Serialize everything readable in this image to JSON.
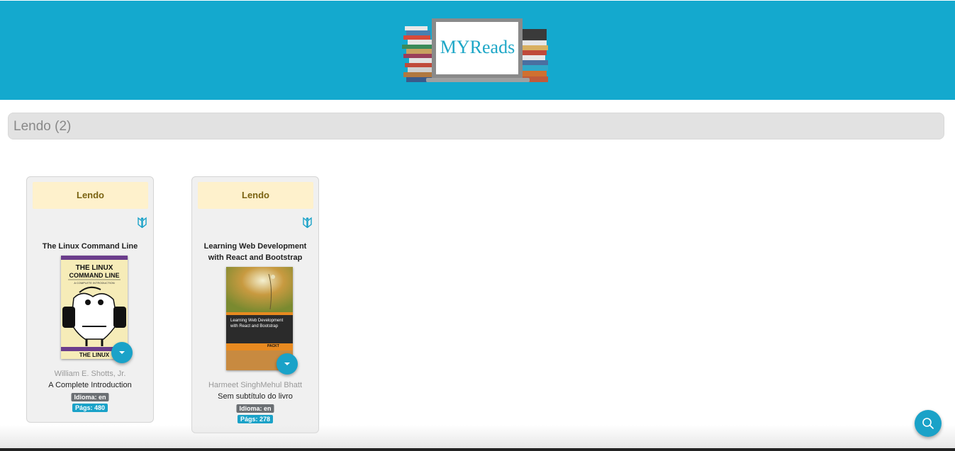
{
  "header": {
    "logo_text": "MYReads"
  },
  "shelf": {
    "title": "Lendo (2)"
  },
  "books": [
    {
      "shelf_label": "Lendo",
      "title": "The Linux Command Line",
      "authors": "William E. Shotts, Jr.",
      "subtitle": "A Complete Introduction",
      "language": "Idioma: en",
      "pages": "Págs: 480",
      "cover": {
        "top_text_1": "THE LINUX",
        "top_text_2": "COMMAND LINE",
        "top_sub": "A COMPLETE INTRODUCTION",
        "bottom_text": "THE LINUX"
      }
    },
    {
      "shelf_label": "Lendo",
      "title": "Learning Web Development with React and Bootstrap",
      "authors": "Harmeet SinghMehul Bhatt",
      "subtitle": "Sem subtítulo do livro",
      "language": "Idioma: en",
      "pages": "Págs: 278",
      "cover": {
        "cover_title": "Learning Web Development with React and Bootstrap",
        "publisher": "PACKT"
      }
    }
  ],
  "icons": {
    "reader": "book-reader-icon",
    "menu": "chevron-down-icon",
    "search": "search-icon"
  },
  "colors": {
    "accent": "#14a9ce",
    "badge_bg": "#fef1cc",
    "lang_tag": "#6b6f73",
    "pages_tag": "#1aa2c8"
  }
}
